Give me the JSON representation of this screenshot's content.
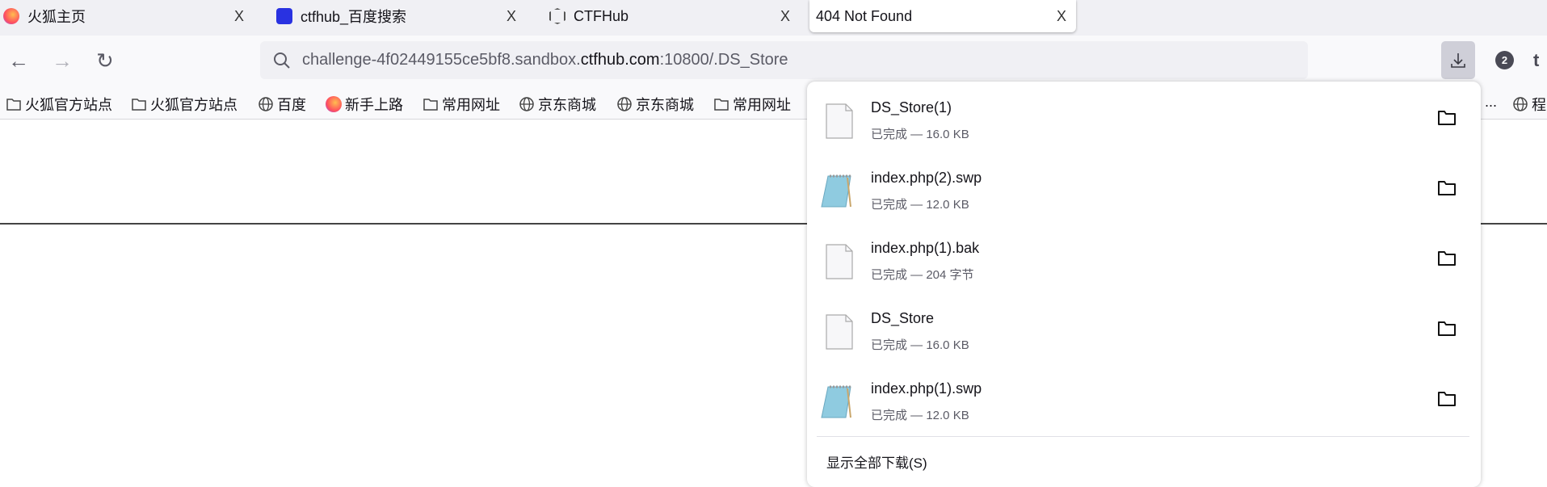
{
  "tabs": [
    {
      "title": "火狐主页",
      "icon": "firefox-icon"
    },
    {
      "title": "ctfhub_百度搜索",
      "icon": "baidu-paw-icon"
    },
    {
      "title": "CTFHub",
      "icon": "ctfhub-logo-icon"
    },
    {
      "title": "404 Not Found",
      "active": true
    }
  ],
  "tab_close": "X",
  "url": {
    "prefix": "challenge-4f02449155ce5bf8.sandbox.",
    "host": "ctfhub.com",
    "suffix": ":10800/.DS_Store"
  },
  "toolbar": {
    "downloads_badge": "2"
  },
  "bookmarks": [
    {
      "label": "火狐官方站点",
      "icon": "folder-icon"
    },
    {
      "label": "火狐官方站点",
      "icon": "folder-icon"
    },
    {
      "label": "百度",
      "icon": "globe-icon"
    },
    {
      "label": "新手上路",
      "icon": "firefox-icon"
    },
    {
      "label": "常用网址",
      "icon": "folder-icon"
    },
    {
      "label": "京东商城",
      "icon": "globe-icon"
    },
    {
      "label": "京东商城",
      "icon": "globe-icon"
    },
    {
      "label": "常用网址",
      "icon": "folder-icon"
    }
  ],
  "bookmarks_right": {
    "truncated": "...",
    "last": "程"
  },
  "downloads": {
    "items": [
      {
        "name": "DS_Store(1)",
        "status": "已完成 — 16.0 KB",
        "icon": "blank-file-icon"
      },
      {
        "name": "index.php(2).swp",
        "status": "已完成 — 12.0 KB",
        "icon": "notepad-file-icon"
      },
      {
        "name": "index.php(1).bak",
        "status": "已完成 — 204 字节",
        "icon": "blank-file-icon"
      },
      {
        "name": "DS_Store",
        "status": "已完成 — 16.0 KB",
        "icon": "blank-file-icon"
      },
      {
        "name": "index.php(1).swp",
        "status": "已完成 — 12.0 KB",
        "icon": "notepad-file-icon"
      }
    ],
    "show_all": "显示全部下载(S)"
  }
}
